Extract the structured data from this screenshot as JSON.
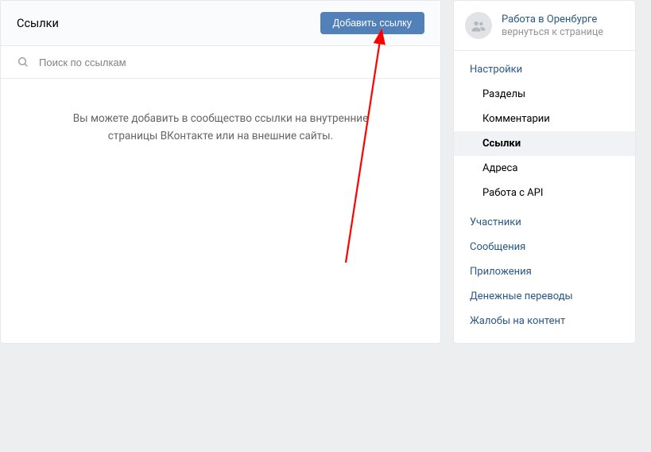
{
  "main": {
    "title": "Ссылки",
    "add_button": "Добавить ссылку",
    "search_placeholder": "Поиск по ссылкам",
    "empty_line1": "Вы можете добавить в сообщество ссылки на внутренние",
    "empty_line2": "страницы ВКонтакте или на внешние сайты."
  },
  "sidebar": {
    "community_name": "Работа в Оренбурге",
    "back_label": "вернуться к странице",
    "nav": {
      "settings": "Настройки",
      "sections": "Разделы",
      "comments": "Комментарии",
      "links": "Ссылки",
      "addresses": "Адреса",
      "api": "Работа с API",
      "members": "Участники",
      "messages": "Сообщения",
      "apps": "Приложения",
      "transfers": "Денежные переводы",
      "complaints": "Жалобы на контент"
    }
  }
}
